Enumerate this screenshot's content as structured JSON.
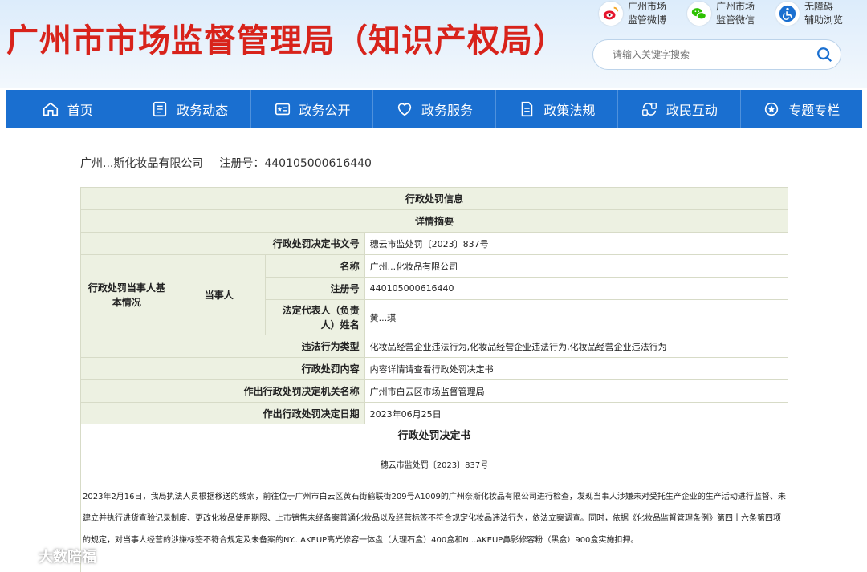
{
  "header": {
    "title": "广州市市场监督管理局（知识产权局）",
    "quick_links": [
      {
        "icon": "weibo-icon",
        "label": "广州市场\n监管微博"
      },
      {
        "icon": "wechat-icon",
        "label": "广州市场\n监管微信"
      },
      {
        "icon": "accessibility-icon",
        "label": "无障碍\n辅助浏览"
      }
    ],
    "search_placeholder": "请输入关键字搜索"
  },
  "nav": [
    {
      "icon": "home-icon",
      "label": "首页"
    },
    {
      "icon": "news-icon",
      "label": "政务动态"
    },
    {
      "icon": "gov-open-icon",
      "label": "政务公开"
    },
    {
      "icon": "heart-icon",
      "label": "政务服务"
    },
    {
      "icon": "document-icon",
      "label": "政策法规"
    },
    {
      "icon": "interact-icon",
      "label": "政民互动"
    },
    {
      "icon": "topic-icon",
      "label": "专题专栏"
    }
  ],
  "company": {
    "name": "广州...斯化妆品有限公司",
    "reg_label": "注册号：",
    "reg_no": "440105000616440"
  },
  "table": {
    "title": "行政处罚信息",
    "subtitle": "详情摘要",
    "doc_no_label": "行政处罚决定书文号",
    "doc_no": "穗云市监处罚〔2023〕837号",
    "party_group": "行政处罚当事人基本情况",
    "party": "当事人",
    "name_label": "名称",
    "name": "广州...化妆品有限公司",
    "reg_label": "注册号",
    "reg": "440105000616440",
    "rep_label": "法定代表人（负责人）姓名",
    "rep": "黄...琪",
    "violation_label": "违法行为类型",
    "violation": "化妆品经营企业违法行为,化妆品经营企业违法行为,化妆品经营企业违法行为",
    "content_label": "行政处罚内容",
    "content": "内容详情请查看行政处罚决定书",
    "org_label": "作出行政处罚决定机关名称",
    "org": "广州市白云区市场监督管理局",
    "date_label": "作出行政处罚决定日期",
    "date": "2023年06月25日"
  },
  "decision": {
    "title": "行政处罚决定书",
    "number": "穗云市监处罚〔2023〕837号",
    "body": "2023年2月16日，我局执法人员根据移送的线索，前往位于广州市白云区黄石街鹤联街209号A1009的广州奈斯化妆品有限公司进行检查，发现当事人涉嫌未对受托生产企业的生产活动进行监督、未建立并执行进货查验记录制度、更改化妆品使用期限、上市销售未经备案普通化妆品以及经营标签不符合规定化妆品违法行为，依法立案调查。同时，依据《化妆品监督管理条例》第四十六条第四项的规定，对当事人经营的涉嫌标签不符合规定及未备案的NY...AKEUP高光修容一体盘（大理石盒）400盒和N...AKEUP鼻影修容粉（黑盒）900盒实施扣押。"
  },
  "watermark": "大数陪福"
}
